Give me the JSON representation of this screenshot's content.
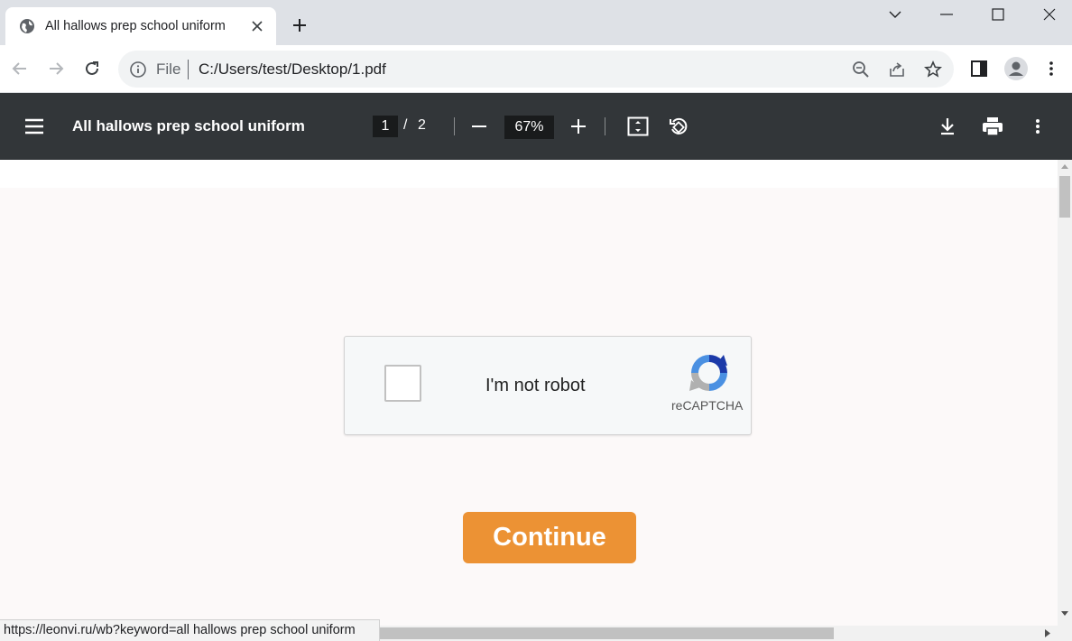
{
  "browser": {
    "tab": {
      "title": "All hallows prep school uniform",
      "favicon": "globe-icon"
    },
    "address": {
      "scheme_label": "File",
      "url": "C:/Users/test/Desktop/1.pdf"
    }
  },
  "pdf_toolbar": {
    "title": "All hallows prep school uniform",
    "current_page": "1",
    "page_separator": "/",
    "total_pages": "2",
    "zoom": "67%"
  },
  "captcha": {
    "label": "I'm not robot",
    "brand": "reCAPTCHA"
  },
  "cta": {
    "label": "Continue",
    "color": "#ec9234"
  },
  "status": {
    "link_url": "https://leonvi.ru/wb?keyword=all hallows prep school uniform"
  },
  "colors": {
    "pdf_bar": "#323639",
    "tab_strip": "#dee1e6",
    "page_bg": "#fcf9f9"
  }
}
